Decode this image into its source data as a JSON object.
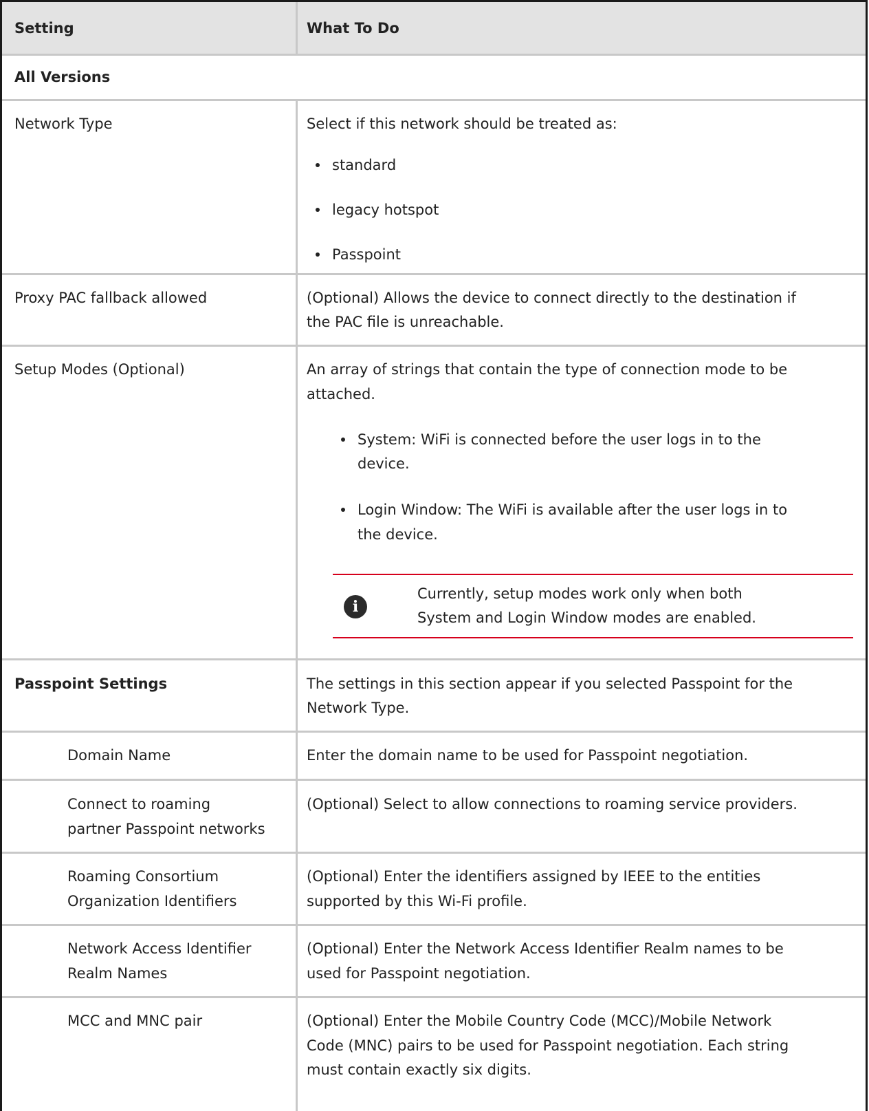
{
  "header": {
    "setting": "Setting",
    "what_to_do": "What To Do"
  },
  "all_versions": "All Versions",
  "network_type": {
    "label": "Network Type",
    "intro": "Select if this network should be treated as:",
    "options": [
      "standard",
      "legacy hotspot",
      "Passpoint"
    ]
  },
  "proxy_pac": {
    "label": "Proxy PAC fallback allowed",
    "desc_line1": "(Optional) Allows the device to connect directly to the destination if",
    "desc_line2": "the PAC file is unreachable."
  },
  "setup_modes": {
    "label": "Setup Modes (Optional)",
    "desc_line1": "An array of strings that contain the type of connection mode to be",
    "desc_line2": "attached.",
    "bullet1_line1": "System: WiFi is connected before the user logs in to the",
    "bullet1_line2": "device.",
    "bullet2_line1": "Login Window: The WiFi is available after the user logs in to",
    "bullet2_line2": "the device.",
    "note_line1": "Currently, setup modes work only when both",
    "note_line2": "System and Login Window modes are enabled."
  },
  "passpoint": {
    "label": "Passpoint Settings",
    "desc_line1": "The settings in this section appear if you selected Passpoint for the",
    "desc_line2": "Network Type."
  },
  "domain_name": {
    "label": "Domain Name",
    "desc": "Enter the domain name to be used for Passpoint negotiation."
  },
  "roaming_partner": {
    "label_line1": "Connect to roaming",
    "label_line2": "partner Passpoint networks",
    "desc": "(Optional) Select to allow connections to roaming service providers."
  },
  "roaming_consortium": {
    "label_line1": "Roaming Consortium",
    "label_line2": "Organization Identifiers",
    "desc_line1": "(Optional) Enter the identifiers assigned by IEEE to the entities",
    "desc_line2": "supported by this Wi-Fi profile."
  },
  "nai_realm": {
    "label_line1": "Network Access Identifier",
    "label_line2": "Realm Names",
    "desc_line1": "(Optional) Enter the Network Access Identifier Realm names to be",
    "desc_line2": "used for Passpoint negotiation."
  },
  "mcc_mnc": {
    "label": "MCC and MNC pair",
    "desc_line1": "(Optional) Enter the Mobile Country Code (MCC)/Mobile Network",
    "desc_line2": "Code (MNC) pairs to be used for Passpoint negotiation. Each string",
    "desc_line3": "must contain exactly six digits."
  },
  "colors": {
    "header_bg": "#e3e3e3",
    "grid": "#c8c8c8",
    "note_rule": "#d6001c",
    "border": "#1a1a1a"
  },
  "icons": {
    "note": "info-icon"
  }
}
